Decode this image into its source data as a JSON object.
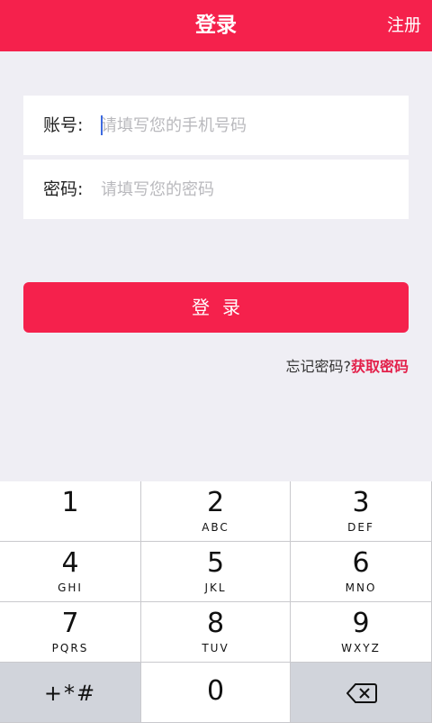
{
  "header": {
    "title": "登录",
    "register_label": "注册"
  },
  "form": {
    "account_label": "账号:",
    "account_placeholder": "请填写您的手机号码",
    "password_label": "密码:",
    "password_placeholder": "请填写您的密码"
  },
  "login_button_label": "登录",
  "forgot": {
    "text": "忘记密码?",
    "link": "获取密码"
  },
  "keypad": {
    "keys": [
      {
        "num": "1",
        "letters": ""
      },
      {
        "num": "2",
        "letters": "ABC"
      },
      {
        "num": "3",
        "letters": "DEF"
      },
      {
        "num": "4",
        "letters": "GHI"
      },
      {
        "num": "5",
        "letters": "JKL"
      },
      {
        "num": "6",
        "letters": "MNO"
      },
      {
        "num": "7",
        "letters": "PQRS"
      },
      {
        "num": "8",
        "letters": "TUV"
      },
      {
        "num": "9",
        "letters": "WXYZ"
      }
    ],
    "symbols": "+*#",
    "zero": "0",
    "delete_icon": "backspace-icon"
  },
  "colors": {
    "accent": "#f5214c",
    "link": "#e3204a",
    "background": "#efeef4"
  }
}
